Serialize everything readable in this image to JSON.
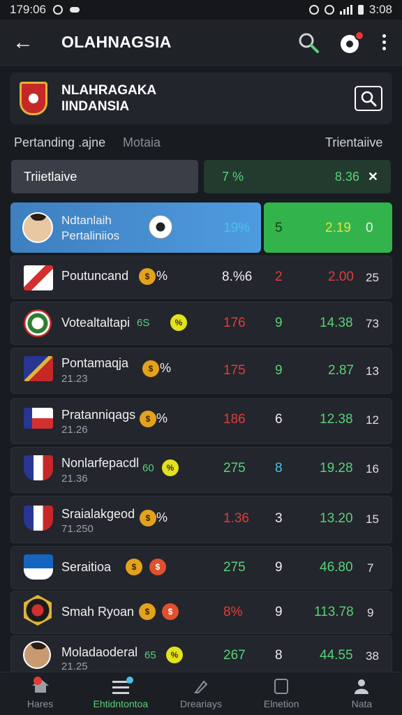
{
  "status_bar": {
    "time_left": "179:06",
    "time_right": "3:08"
  },
  "app_bar": {
    "title": "OLAHNAGSIA"
  },
  "league": {
    "line1": "NLAHRAGAKA",
    "line2": "IINDANSIA"
  },
  "tabs": [
    "Pertanding .ajne",
    "Motaia",
    "Trientaiive"
  ],
  "filter": {
    "label": "Triietlaive",
    "odds_a": "7 %",
    "odds_b": "8.36"
  },
  "highlight": {
    "name": "Ndtanlaih",
    "sub": "Pertaliniios",
    "pct": "19%",
    "col1": "5",
    "col2": "2.19",
    "col3": "0"
  },
  "matches": [
    {
      "name": "Poutuncand",
      "sub": "",
      "tag": "%",
      "c1": "8.%6",
      "c2": "2",
      "c3": "2.00",
      "c4": "25"
    },
    {
      "name": "Votealtaltapi",
      "sub": "",
      "tag": "6S",
      "c1": "176",
      "c2": "9",
      "c3": "14.38",
      "c4": "73"
    },
    {
      "name": "Pontamaqja",
      "sub": "21.23",
      "tag": "%",
      "c1": "175",
      "c2": "9",
      "c3": "2.87",
      "c4": "13"
    },
    {
      "name": "Pratanniqags",
      "sub": "21.26",
      "tag": "%",
      "c1": "186",
      "c2": "6",
      "c3": "12.38",
      "c4": "12"
    },
    {
      "name": "Nonlarfepacdl",
      "sub": "21.36",
      "tag": "60",
      "c1": "275",
      "c2": "8",
      "c3": "19.28",
      "c4": "16"
    },
    {
      "name": "Sraialakgeod",
      "sub": "71.250",
      "tag": "%",
      "c1": "1.36",
      "c2": "3",
      "c3": "13.20",
      "c4": "15"
    },
    {
      "name": "Seraitioa",
      "sub": "",
      "tag": "",
      "c1": "275",
      "c2": "9",
      "c3": "46.80",
      "c4": "7"
    },
    {
      "name": "Smah Ryoan",
      "sub": "",
      "tag": "",
      "c1": "8%",
      "c2": "9",
      "c3": "113.78",
      "c4": "9"
    },
    {
      "name": "Moladaoderal",
      "sub": "21.25",
      "tag": "65",
      "c1": "267",
      "c2": "8",
      "c3": "44.55",
      "c4": "38"
    }
  ],
  "bottom_nav": [
    "Hares",
    "Ehtidntontoa",
    "Dreariays",
    "Elnetion",
    "Nata"
  ]
}
